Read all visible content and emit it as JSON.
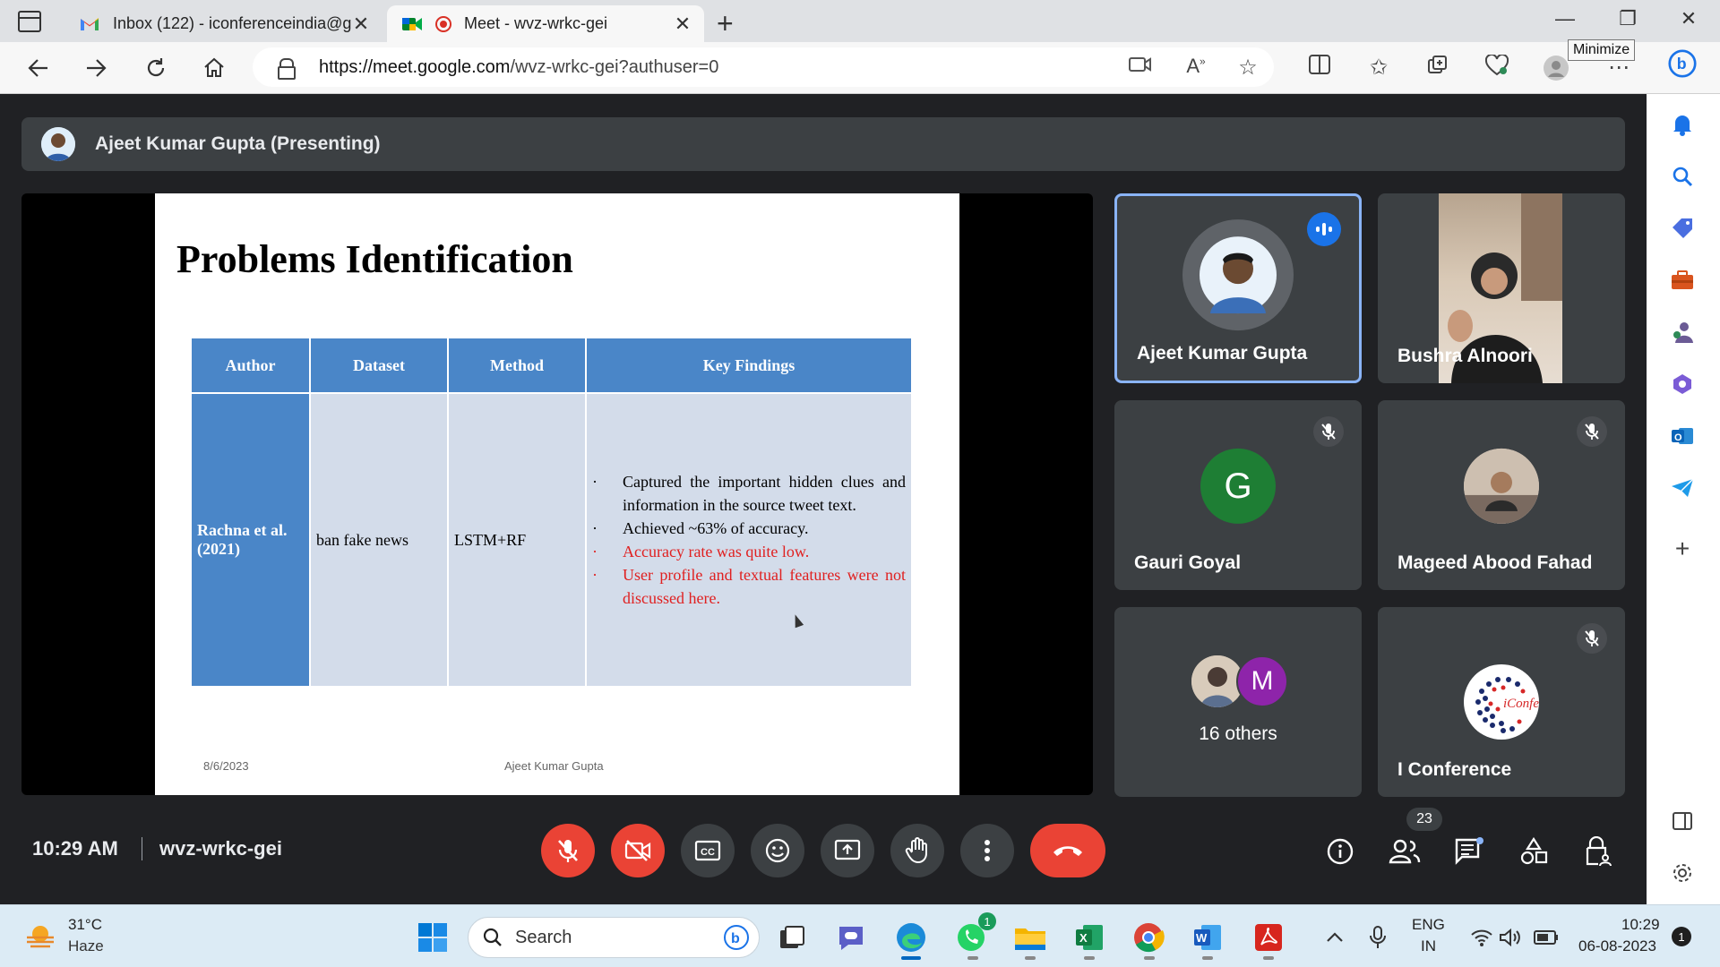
{
  "browser": {
    "tabs": [
      {
        "title": "Inbox (122) - iconferenceindia@g",
        "active": false
      },
      {
        "title": "Meet - wvz-wrkc-gei",
        "active": true
      }
    ],
    "window_tooltip": "Minimize",
    "url_host": "https://meet.google.com",
    "url_path": "/wvz-wrkc-gei?authuser=0"
  },
  "meet": {
    "presenter_banner": "Ajeet Kumar Gupta (Presenting)",
    "slide": {
      "title": "Problems Identification",
      "table": {
        "headers": [
          "Author",
          "Dataset",
          "Method",
          "Key Findings"
        ],
        "row": {
          "author": "Rachna et al. (2021)",
          "dataset": "ban fake news",
          "method": "LSTM+RF",
          "findings": [
            {
              "text": "Captured the important hidden clues and information in the source tweet text.",
              "highlight": false
            },
            {
              "text": "Achieved ~63% of accuracy.",
              "highlight": false
            },
            {
              "text": "Accuracy rate was quite low.",
              "highlight": true
            },
            {
              "text": "User profile and textual features were not discussed here.",
              "highlight": true
            }
          ]
        }
      },
      "date": "8/6/2023",
      "footer": "Ajeet Kumar Gupta"
    },
    "participants": [
      {
        "name": "Ajeet Kumar Gupta",
        "speaking": true
      },
      {
        "name": "Bushra Alnoori"
      },
      {
        "name": "Gauri Goyal",
        "initial": "G",
        "avatar_color": "#1e7e34"
      },
      {
        "name": "Mageed Abood Fahad"
      },
      {
        "name": "16 others",
        "initial": "M",
        "avatar_color": "#8e24aa"
      },
      {
        "name": "I Conference",
        "logo_text": "iConfer"
      }
    ],
    "time": "10:29 AM",
    "meeting_code": "wvz-wrkc-gei",
    "participant_count": "23"
  },
  "taskbar": {
    "weather_temp": "31°C",
    "weather_condition": "Haze",
    "search_placeholder": "Search",
    "whatsapp_badge": "1",
    "lang": "ENG",
    "region": "IN",
    "clock_time": "10:29",
    "clock_date": "06-08-2023",
    "notification_count": "1"
  },
  "colors": {
    "meet_bg": "#202124",
    "tile_bg": "#3c4043",
    "end_call": "#ea4335",
    "slide_header": "#4a86c8",
    "slide_cell": "#d3dcea",
    "highlight_text": "#e02020"
  }
}
